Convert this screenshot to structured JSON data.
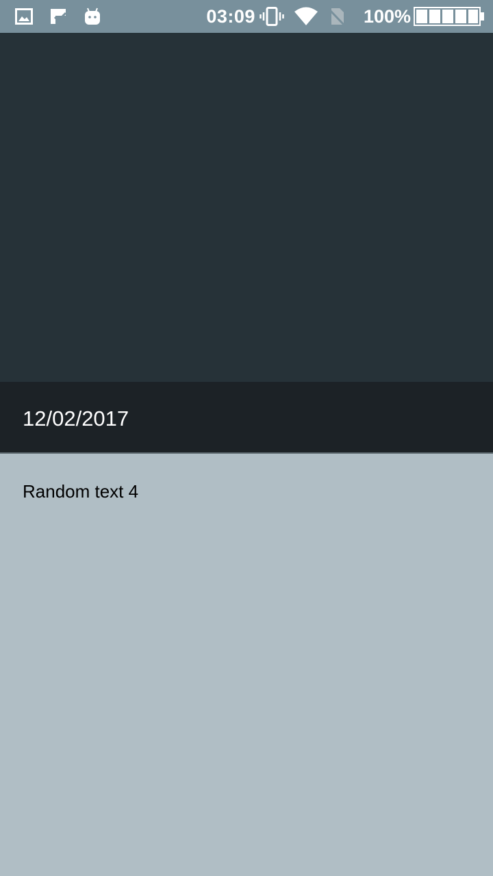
{
  "status_bar": {
    "time": "03:09",
    "battery_percent": "100%",
    "left_icons": [
      "image-icon",
      "check-flag-icon",
      "android-icon"
    ],
    "right_icons": [
      "vibrate-icon",
      "wifi-icon",
      "no-sim-icon",
      "battery-icon"
    ],
    "background": "#78909c"
  },
  "header": {
    "background": "#263238"
  },
  "date_bar": {
    "date": "12/02/2017",
    "background": "#1c2226"
  },
  "content": {
    "text": "Random text 4",
    "background": "#b0bec5"
  }
}
